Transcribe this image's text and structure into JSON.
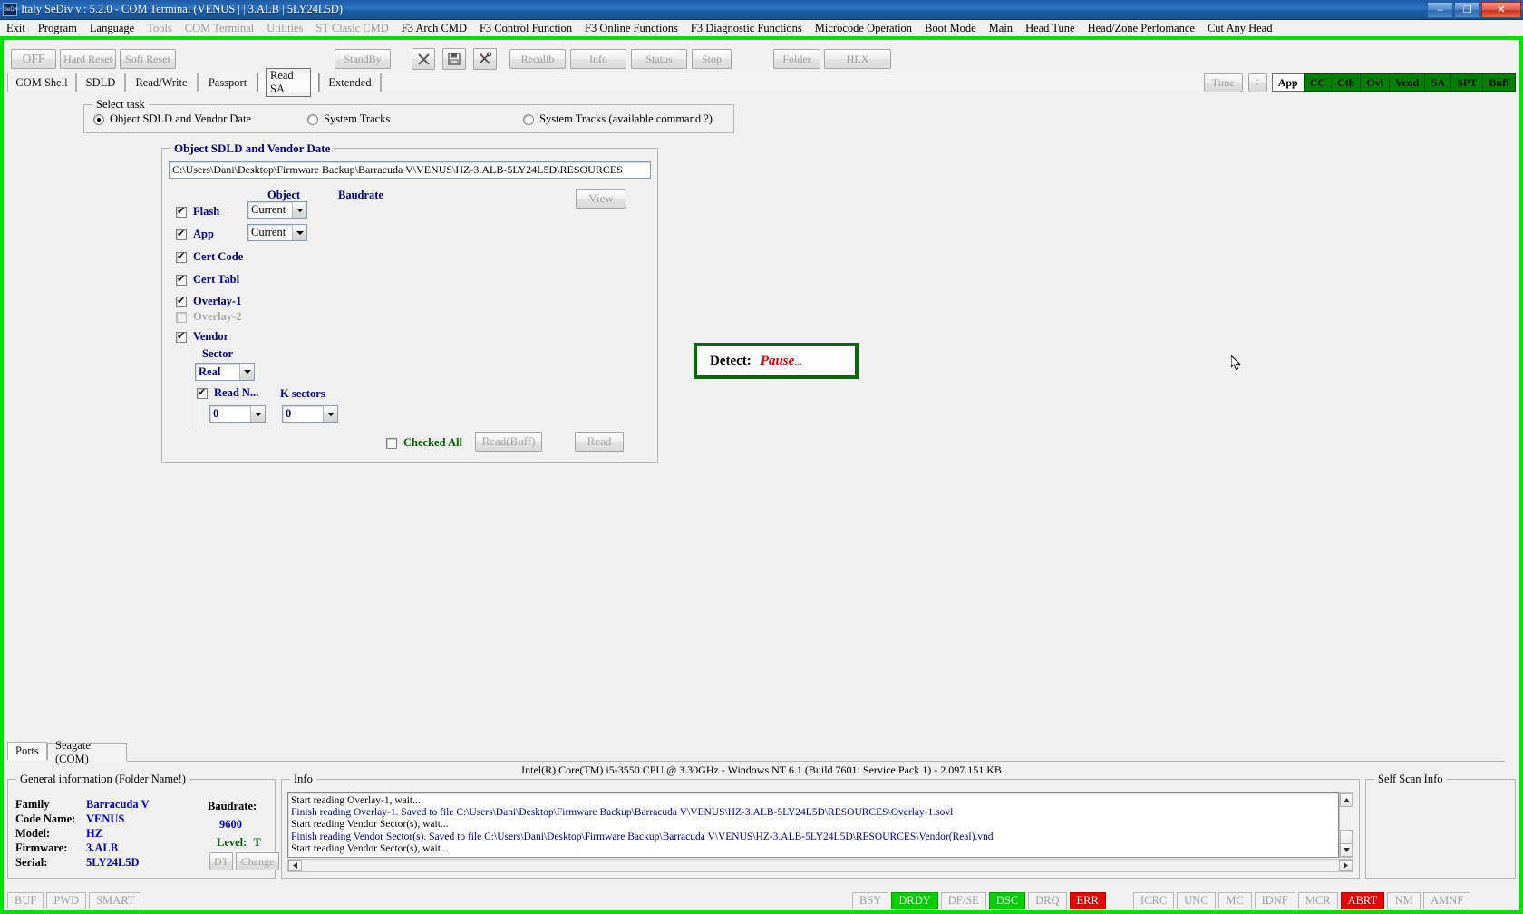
{
  "titlebar": {
    "icon": "app-icon",
    "title": "Italy  SeDiv v.: 5.2.0 - COM Terminal  (VENUS |  | 3.ALB | 5LY24L5D)",
    "minimize": "–",
    "maximize": "❐",
    "close": "✕"
  },
  "menubar": [
    {
      "label": "Exit",
      "disabled": false
    },
    {
      "label": "Program",
      "disabled": false
    },
    {
      "label": "Language",
      "disabled": false
    },
    {
      "label": "Tools",
      "disabled": true
    },
    {
      "label": "COM Terminal",
      "disabled": true
    },
    {
      "label": "Utilities",
      "disabled": true
    },
    {
      "label": "ST Clasic CMD",
      "disabled": true
    },
    {
      "label": "F3 Arch CMD",
      "disabled": false
    },
    {
      "label": "F3 Control Function",
      "disabled": false
    },
    {
      "label": "F3 Online Functions",
      "disabled": false
    },
    {
      "label": "F3 Diagnostic Functions",
      "disabled": false
    },
    {
      "label": "Microcode Operation",
      "disabled": false
    },
    {
      "label": "Boot Mode",
      "disabled": false
    },
    {
      "label": "Main",
      "disabled": false
    },
    {
      "label": "Head Tune",
      "disabled": false
    },
    {
      "label": "Head/Zone Perfomance",
      "disabled": false
    },
    {
      "label": "Cut Any Head",
      "disabled": false
    }
  ],
  "toolbar": {
    "off": "OFF",
    "hard_reset": "Hard Reset",
    "soft_reset": "Soft Reset",
    "standby": "StandBy",
    "recalib": "Recalib",
    "info": "Info",
    "status": "Status",
    "stop": "Stop",
    "folder": "Folder",
    "hex": "HEX",
    "icon_close": "close-x-icon",
    "icon_save": "floppy-save-icon",
    "icon_tools": "tools-icon"
  },
  "tabs": [
    {
      "label": "COM Shell",
      "selected": false
    },
    {
      "label": "SDLD",
      "selected": false
    },
    {
      "label": "Read/Write",
      "selected": false
    },
    {
      "label": "Passport",
      "selected": false
    },
    {
      "label": "Read SA",
      "selected": true
    },
    {
      "label": "Extended",
      "selected": false
    }
  ],
  "leds": {
    "time_button": "Time",
    "colon_button": "∶",
    "items": [
      {
        "label": "App",
        "state": "white"
      },
      {
        "label": "CC",
        "state": "on"
      },
      {
        "label": "Ctb",
        "state": "on"
      },
      {
        "label": "Ovl",
        "state": "on"
      },
      {
        "label": "Vend",
        "state": "on"
      },
      {
        "label": "SA",
        "state": "on"
      },
      {
        "label": "SPT",
        "state": "on"
      },
      {
        "label": "Buff",
        "state": "on"
      }
    ]
  },
  "select_task": {
    "legend": "Select task",
    "options": [
      {
        "label": "Object SDLD and Vendor Date",
        "selected": true
      },
      {
        "label": "System Tracks",
        "selected": false
      },
      {
        "label": "System Tracks (available command ?)",
        "selected": false
      }
    ]
  },
  "object_group": {
    "legend": "Object SDLD and Vendor Date",
    "path_value": "C:\\Users\\Dani\\Desktop\\Firmware Backup\\Barracuda V\\VENUS\\HZ-3.ALB-5LY24L5D\\RESOURCES",
    "view_button": "View",
    "col_object": "Object",
    "col_baudrate": "Baudrate",
    "rows": [
      {
        "label": "Flash",
        "checked": true,
        "disabled": false,
        "baudrate": "Current"
      },
      {
        "label": "App",
        "checked": true,
        "disabled": false,
        "baudrate": "Current"
      },
      {
        "label": "Cert Code",
        "checked": true,
        "disabled": false,
        "baudrate": null
      },
      {
        "label": "Cert Tabl",
        "checked": true,
        "disabled": false,
        "baudrate": null
      },
      {
        "label": "Overlay-1",
        "checked": true,
        "disabled": false,
        "baudrate": null
      },
      {
        "label": "Overlay-2",
        "checked": false,
        "disabled": true,
        "baudrate": null
      },
      {
        "label": "Vendor",
        "checked": true,
        "disabled": false,
        "baudrate": null
      }
    ],
    "sector_label": "Sector",
    "sector_value": "Real",
    "read_n_label": "Read N...",
    "read_n_checked": true,
    "k_sectors_label": "K sectors",
    "read_n_value": "0",
    "k_sectors_value": "0",
    "checked_all_label": "Checked All",
    "checked_all_checked": false,
    "read_buff_button": "Read(Buff)",
    "read_button": "Read"
  },
  "detect": {
    "label": "Detect:",
    "value": "Pause",
    "dots": "..."
  },
  "bottom_tabs": [
    {
      "label": "Ports",
      "selected": true
    },
    {
      "label": "Seagate (COM)",
      "selected": false
    }
  ],
  "cpu_line": "Intel(R) Core(TM) i5-3550 CPU @ 3.30GHz - Windows NT 6.1 (Build 7601: Service Pack 1)  -  2.097.151 KB",
  "general_info": {
    "legend": "General information (Folder Name!)",
    "fields": [
      {
        "key": "Family",
        "value": "Barracuda V"
      },
      {
        "key": "Code Name:",
        "value": "VENUS"
      },
      {
        "key": "Model:",
        "value": "HZ"
      },
      {
        "key": "Firmware:",
        "value": "3.ALB"
      },
      {
        "key": "Serial:",
        "value": "5LY24L5D"
      }
    ],
    "baudrate_label": "Baudrate:",
    "baudrate_value": "9600",
    "level_label": "Level:",
    "level_value": "T",
    "dt_button": "DT",
    "change_button": "Change"
  },
  "info_panel": {
    "legend": "Info",
    "lines": [
      {
        "text": "Start reading Overlay-1, wait...",
        "color": "black"
      },
      {
        "text": "Finish reading Overlay-1. Saved to file C:\\Users\\Dani\\Desktop\\Firmware Backup\\Barracuda V\\VENUS\\HZ-3.ALB-5LY24L5D\\RESOURCES\\Overlay-1.sovl",
        "color": "blue"
      },
      {
        "text": "Start reading Vendor Sector(s), wait...",
        "color": "black"
      },
      {
        "text": "Finish reading Vendor Sector(s). Saved to file C:\\Users\\Dani\\Desktop\\Firmware Backup\\Barracuda V\\VENUS\\HZ-3.ALB-5LY24L5D\\RESOURCES\\Vendor(Real).vnd",
        "color": "blue"
      },
      {
        "text": "Start reading Vendor Sector(s), wait...",
        "color": "black"
      }
    ]
  },
  "self_scan": {
    "legend": "Self Scan Info"
  },
  "status_flags_left": [
    {
      "label": "BUF",
      "state": "off"
    },
    {
      "label": "PWD",
      "state": "off"
    },
    {
      "label": "SMART",
      "state": "off"
    }
  ],
  "status_flags_mid": [
    {
      "label": "BSY",
      "state": "off"
    },
    {
      "label": "DRDY",
      "state": "green"
    },
    {
      "label": "DF/SE",
      "state": "off"
    },
    {
      "label": "DSC",
      "state": "green"
    },
    {
      "label": "DRQ",
      "state": "off"
    },
    {
      "label": "ERR",
      "state": "red"
    }
  ],
  "status_flags_right": [
    {
      "label": "ICRC",
      "state": "off"
    },
    {
      "label": "UNC",
      "state": "off"
    },
    {
      "label": "MC",
      "state": "off"
    },
    {
      "label": "IDNF",
      "state": "off"
    },
    {
      "label": "MCR",
      "state": "off"
    },
    {
      "label": "ABRT",
      "state": "red"
    },
    {
      "label": "NM",
      "state": "off"
    },
    {
      "label": "AMNF",
      "state": "off"
    }
  ],
  "colors": {
    "frame_green": "#00e000",
    "led_green": "#008000",
    "flag_green": "#00d000",
    "flag_red": "#ea0000",
    "label_navy": "#000080",
    "value_blue": "#0000c0",
    "detect_red": "#d00000",
    "detect_border": "#006a00"
  }
}
